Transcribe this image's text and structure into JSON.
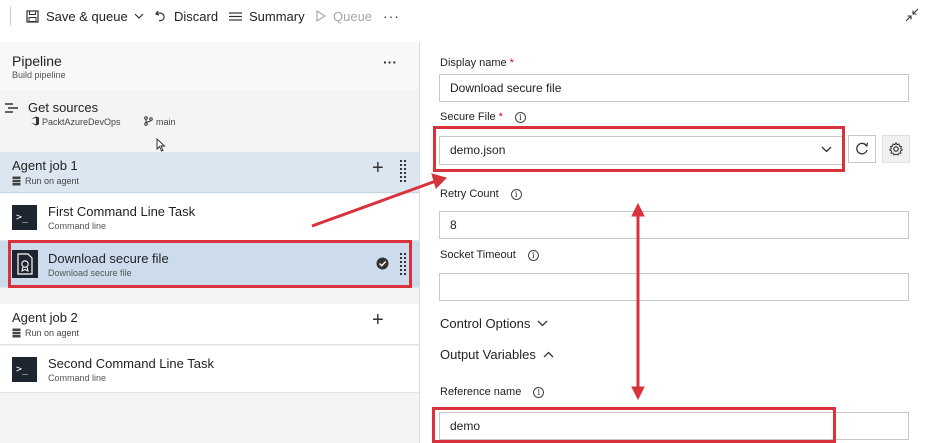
{
  "toolbar": {
    "save_queue": "Save & queue",
    "discard": "Discard",
    "summary": "Summary",
    "queue": "Queue",
    "more": "···"
  },
  "pipeline": {
    "title": "Pipeline",
    "subtitle": "Build pipeline",
    "more": "···"
  },
  "get_sources": {
    "title": "Get sources",
    "repo": "PacktAzureDevOps",
    "branch": "main"
  },
  "jobs": [
    {
      "title": "Agent job 1",
      "subtitle": "Run on agent",
      "tasks": [
        {
          "title": "First Command Line Task",
          "subtitle": "Command line",
          "icon": "command-line-icon"
        },
        {
          "title": "Download secure file",
          "subtitle": "Download secure file",
          "icon": "secure-file-icon",
          "selected": true
        }
      ]
    },
    {
      "title": "Agent job 2",
      "subtitle": "Run on agent",
      "tasks": [
        {
          "title": "Second Command Line Task",
          "subtitle": "Command line",
          "icon": "command-line-icon"
        }
      ]
    }
  ],
  "form": {
    "display_name_label": "Display name",
    "display_name_value": "Download secure file",
    "secure_file_label": "Secure File",
    "secure_file_value": "demo.json",
    "retry_count_label": "Retry Count",
    "retry_count_value": "8",
    "socket_timeout_label": "Socket Timeout",
    "socket_timeout_value": "",
    "control_options": "Control Options",
    "output_variables": "Output Variables",
    "reference_name_label": "Reference name",
    "reference_name_value": "demo",
    "required_marker": "*",
    "info_glyph": "i"
  },
  "colors": {
    "selection": "#cddcec",
    "job_header": "#dce6f1",
    "annotation_red": "#d9323c",
    "panel_bg": "#f4f4f4"
  }
}
